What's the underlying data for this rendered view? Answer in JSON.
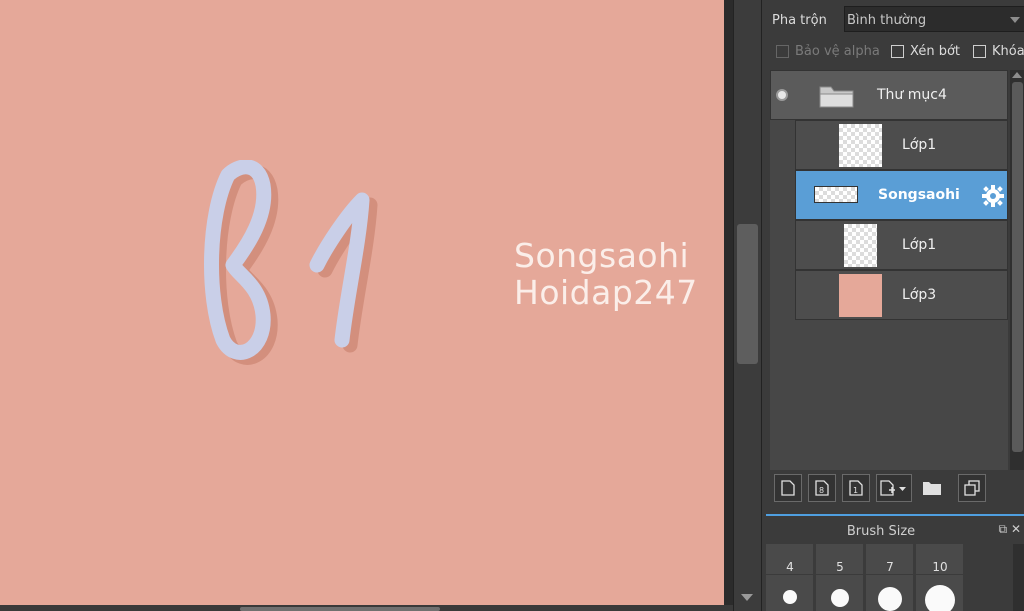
{
  "canvas": {
    "background_color": "#e5a899",
    "watermark_lines": [
      "Songsaohi",
      "Hoidap247"
    ]
  },
  "panel": {
    "blend_label": "Pha trộn",
    "blend_value": "Bình thường",
    "options": [
      {
        "label": "Bảo vệ alpha",
        "checked": false,
        "enabled": false
      },
      {
        "label": "Xén bớt",
        "checked": false,
        "enabled": true
      },
      {
        "label": "Khóa",
        "checked": false,
        "enabled": true
      }
    ]
  },
  "layers": {
    "folder": {
      "name": "Thư mục4",
      "icon": "folder-icon"
    },
    "items": [
      {
        "name": "Lớp1",
        "selected": false,
        "thumb": "transparent"
      },
      {
        "name": "Songsaohi",
        "selected": true,
        "thumb": "transparent-wide",
        "icon": "gear-icon"
      },
      {
        "name": "Lớp1",
        "selected": false,
        "thumb": "transparent"
      },
      {
        "name": "Lớp3",
        "selected": false,
        "thumb": "solid-pink"
      }
    ]
  },
  "layer_tools": [
    "new-layer-icon",
    "new-8bit-layer-icon",
    "new-1bit-layer-icon",
    "add-layer-dropdown-icon",
    "new-folder-icon",
    "duplicate-layer-icon"
  ],
  "brush_panel": {
    "title": "Brush Size",
    "sizes": [
      "4",
      "5",
      "7",
      "10"
    ]
  },
  "colors": {
    "accent": "#5a9ed6",
    "panel_bg": "#3b3b3b",
    "canvas": "#e5a899",
    "lettering": "#c9cfe8",
    "lettering_shadow": "#d38f7d"
  }
}
